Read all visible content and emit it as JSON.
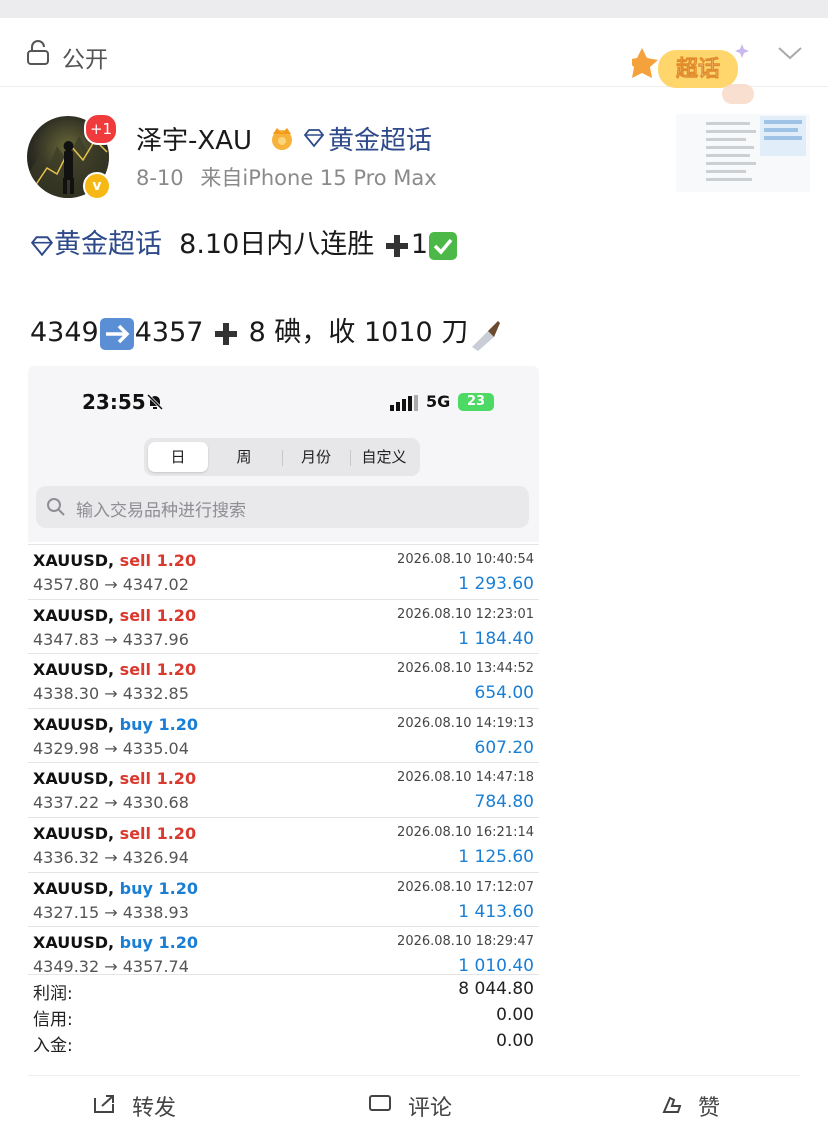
{
  "colors": {
    "link": "#2e4a8a",
    "sell": "#d93a2f",
    "buy": "#1a7fd4",
    "profit": "#1a7fd4"
  },
  "header": {
    "visibility": "公开",
    "visibility_icon": "lock-icon",
    "sticker": "超话",
    "more_icon": "chevron-down-icon"
  },
  "author": {
    "name": "泽宇-XAU",
    "topic": "黄金超话",
    "date": "8-10",
    "source": "来自iPhone 15 Pro Max",
    "notif_badge": "+1",
    "verified_badge": "v"
  },
  "post": {
    "hashtag": "黄金超话",
    "line1_text": "8.10日内八连胜",
    "line1_suffix": "1",
    "line2_from": "4349",
    "line2_to": "4357",
    "line2_rest": "8 碘，收 1010 刀"
  },
  "screenshot": {
    "time": "23:55",
    "network": "5G",
    "battery": "23",
    "tabs": [
      {
        "label": "日",
        "active": true
      },
      {
        "label": "周",
        "active": false
      },
      {
        "label": "月份",
        "active": false
      },
      {
        "label": "自定义",
        "active": false
      }
    ],
    "search_placeholder": "输入交易品种进行搜索",
    "trades": [
      {
        "symbol": "XAUUSD,",
        "side": "sell",
        "lots": "1.20",
        "prices": "4357.80 → 4347.02",
        "time": "2026.08.10 10:40:54",
        "profit": "1 293.60"
      },
      {
        "symbol": "XAUUSD,",
        "side": "sell",
        "lots": "1.20",
        "prices": "4347.83 → 4337.96",
        "time": "2026.08.10 12:23:01",
        "profit": "1 184.40"
      },
      {
        "symbol": "XAUUSD,",
        "side": "sell",
        "lots": "1.20",
        "prices": "4338.30 → 4332.85",
        "time": "2026.08.10 13:44:52",
        "profit": "654.00"
      },
      {
        "symbol": "XAUUSD,",
        "side": "buy",
        "lots": "1.20",
        "prices": "4329.98 → 4335.04",
        "time": "2026.08.10 14:19:13",
        "profit": "607.20"
      },
      {
        "symbol": "XAUUSD,",
        "side": "sell",
        "lots": "1.20",
        "prices": "4337.22 → 4330.68",
        "time": "2026.08.10 14:47:18",
        "profit": "784.80"
      },
      {
        "symbol": "XAUUSD,",
        "side": "sell",
        "lots": "1.20",
        "prices": "4336.32 → 4326.94",
        "time": "2026.08.10 16:21:14",
        "profit": "1 125.60"
      },
      {
        "symbol": "XAUUSD,",
        "side": "buy",
        "lots": "1.20",
        "prices": "4327.15 → 4338.93",
        "time": "2026.08.10 17:12:07",
        "profit": "1 413.60"
      },
      {
        "symbol": "XAUUSD,",
        "side": "buy",
        "lots": "1.20",
        "prices": "4349.32 → 4357.74",
        "time": "2026.08.10 18:29:47",
        "profit": "1 010.40"
      }
    ],
    "summary": [
      {
        "label": "利润:",
        "value": "8 044.80"
      },
      {
        "label": "信用:",
        "value": "0.00"
      },
      {
        "label": "入金:",
        "value": "0.00"
      }
    ]
  },
  "actions": [
    {
      "label": "转发",
      "icon": "share-icon"
    },
    {
      "label": "评论",
      "icon": "comment-icon"
    },
    {
      "label": "赞",
      "icon": "like-icon"
    }
  ]
}
